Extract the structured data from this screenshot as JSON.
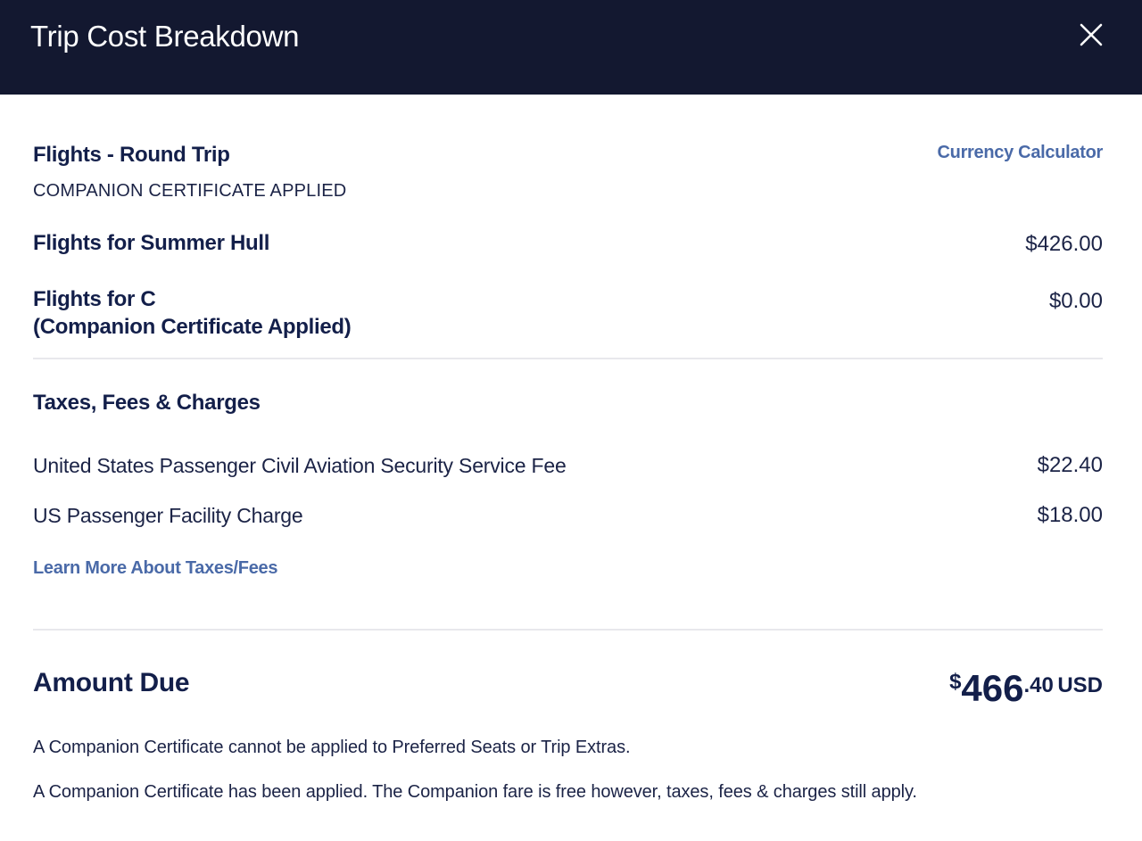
{
  "header": {
    "title": "Trip Cost Breakdown",
    "close_icon": "close-icon"
  },
  "flights": {
    "section_title": "Flights - Round Trip",
    "currency_calculator_link": "Currency Calculator",
    "certificate_status": "COMPANION CERTIFICATE APPLIED",
    "passengers": [
      {
        "label": "Flights for Summer Hull",
        "sublabel": "",
        "amount": "$426.00"
      },
      {
        "label": "Flights for C",
        "sublabel": "(Companion Certificate Applied)",
        "amount": "$0.00"
      }
    ]
  },
  "taxes": {
    "section_title": "Taxes, Fees & Charges",
    "items": [
      {
        "label": "United States Passenger Civil Aviation Security Service Fee",
        "amount": "$22.40"
      },
      {
        "label": "US Passenger Facility Charge",
        "amount": "$18.00"
      }
    ],
    "learn_more_link": "Learn More About Taxes/Fees"
  },
  "amount_due": {
    "label": "Amount Due",
    "currency_symbol": "$",
    "whole": "466",
    "cents": ".40",
    "currency_code": "USD"
  },
  "notes": [
    "A Companion Certificate cannot be applied to Preferred Seats or Trip Extras.",
    "A Companion Certificate has been applied. The Companion fare is free however, taxes, fees & charges still apply."
  ]
}
